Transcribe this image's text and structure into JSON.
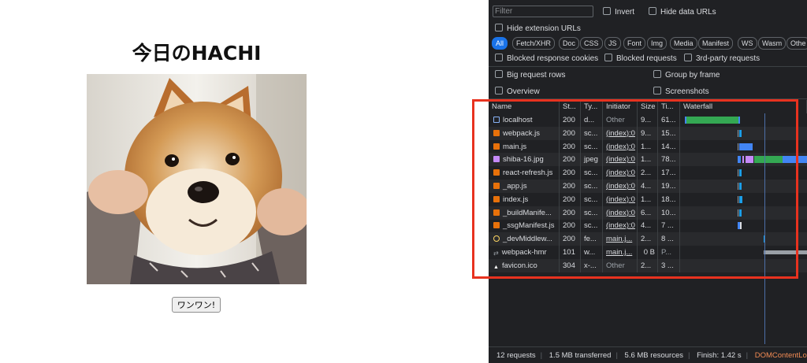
{
  "page": {
    "title": "今日のHACHI",
    "button_label": "ワンワン!"
  },
  "devtools": {
    "filter": {
      "placeholder": "Filter",
      "value": ""
    },
    "options": {
      "invert": "Invert",
      "hide_data_urls": "Hide data URLs",
      "hide_extension_urls": "Hide extension URLs",
      "blocked_response_cookies": "Blocked response cookies",
      "blocked_requests": "Blocked requests",
      "third_party": "3rd-party requests",
      "big_request_rows": "Big request rows",
      "group_by_frame": "Group by frame",
      "overview": "Overview",
      "screenshots": "Screenshots"
    },
    "type_filters": [
      "All",
      "Fetch/XHR",
      "Doc",
      "CSS",
      "JS",
      "Font",
      "Img",
      "Media",
      "Manifest",
      "WS",
      "Wasm",
      "Othe"
    ],
    "columns": [
      "Name",
      "St...",
      "Ty...",
      "Initiator",
      "Size",
      "Ti...",
      "Waterfall"
    ],
    "rows": [
      {
        "icon": "doc",
        "name": "localhost",
        "status": "200",
        "type": "d...",
        "initiator": "Other",
        "size": "9...",
        "time": "61..."
      },
      {
        "icon": "js",
        "name": "webpack.js",
        "status": "200",
        "type": "sc...",
        "initiator": "(index):0",
        "size": "9...",
        "time": "15..."
      },
      {
        "icon": "js",
        "name": "main.js",
        "status": "200",
        "type": "sc...",
        "initiator": "(index):0",
        "size": "1...",
        "time": "14..."
      },
      {
        "icon": "img",
        "name": "shiba-16.jpg",
        "status": "200",
        "type": "jpeg",
        "initiator": "(index):0",
        "size": "1...",
        "time": "78..."
      },
      {
        "icon": "js",
        "name": "react-refresh.js",
        "status": "200",
        "type": "sc...",
        "initiator": "(index):0",
        "size": "2...",
        "time": "17..."
      },
      {
        "icon": "js",
        "name": "_app.js",
        "status": "200",
        "type": "sc...",
        "initiator": "(index):0",
        "size": "4...",
        "time": "19..."
      },
      {
        "icon": "js",
        "name": "index.js",
        "status": "200",
        "type": "sc...",
        "initiator": "(index):0",
        "size": "1...",
        "time": "18..."
      },
      {
        "icon": "js",
        "name": "_buildManife...",
        "status": "200",
        "type": "sc...",
        "initiator": "(index):0",
        "size": "6...",
        "time": "10..."
      },
      {
        "icon": "js",
        "name": "_ssgManifest.js",
        "status": "200",
        "type": "sc...",
        "initiator": "(index):0",
        "size": "4...",
        "time": "7 ..."
      },
      {
        "icon": "fetch",
        "name": "_devMiddlew...",
        "status": "200",
        "type": "fe...",
        "initiator": "main.j...",
        "size": "2...",
        "time": "8 ..."
      },
      {
        "icon": "ws",
        "name": "webpack-hmr",
        "status": "101",
        "type": "w...",
        "initiator": "main.j...",
        "size": "0 B",
        "time": "P..."
      },
      {
        "icon": "fav",
        "name": "favicon.ico",
        "status": "304",
        "type": "x-...",
        "initiator": "Other",
        "size": "2...",
        "time": "3 ..."
      }
    ],
    "status_bar": {
      "requests": "12 requests",
      "transferred": "1.5 MB transferred",
      "resources": "5.6 MB resources",
      "finish": "Finish: 1.42 s",
      "dom": "DOMContentLoa"
    },
    "colors": {
      "background": "#202124",
      "active_chip": "#1a73e8",
      "highlight_box": "#e8321f",
      "waterfall_green": "#34a853",
      "waterfall_blue": "#4285f4",
      "dom_content_loaded": "#f28b54"
    }
  }
}
